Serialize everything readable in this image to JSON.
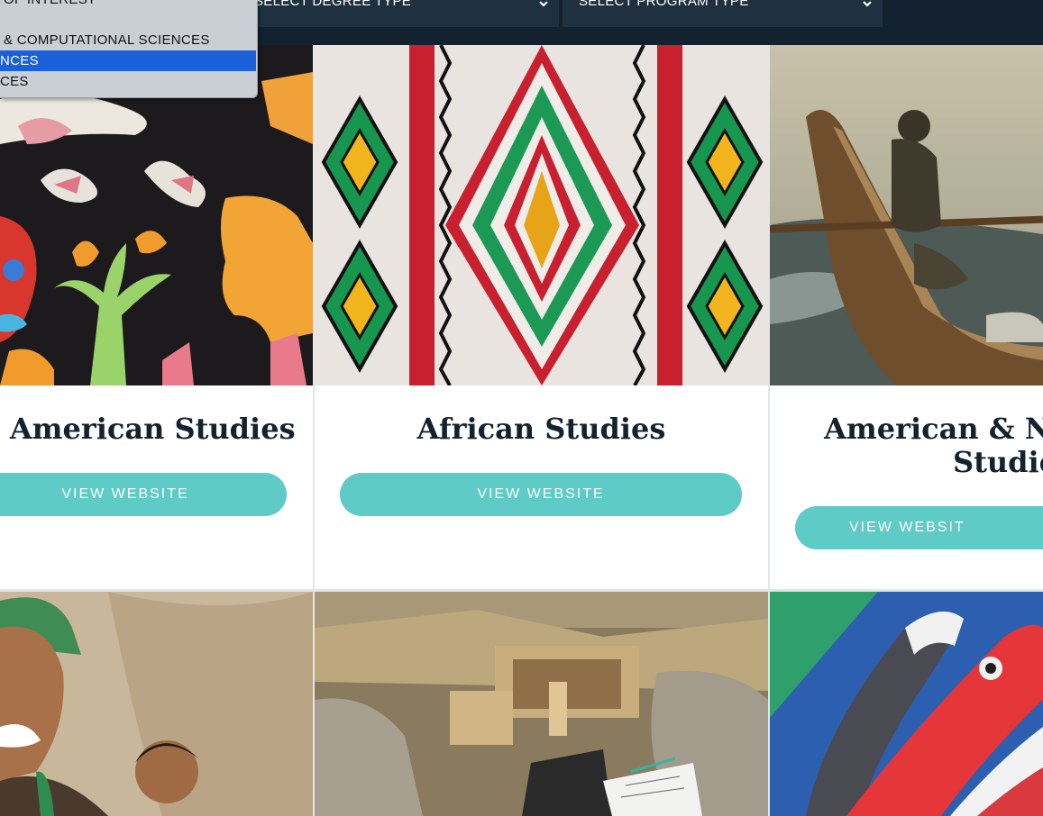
{
  "filters": {
    "area_partial": "OF INTEREST",
    "degree_label": "SELECT DEGREE TYPE",
    "program_label": "SELECT PROGRAM TYPE"
  },
  "dropdown": {
    "options": [
      "OF INTEREST",
      "& COMPUTATIONAL SCIENCES",
      "NCES",
      "CES"
    ],
    "selected_index": 2
  },
  "cards": [
    {
      "title": "n American Studies",
      "button": "VIEW WEBSITE"
    },
    {
      "title": "African Studies",
      "button": "VIEW WEBSITE"
    },
    {
      "title_line1": "American & New",
      "title_line2": "Studies",
      "button": "VIEW WEBSIT"
    }
  ],
  "colors": {
    "topbar": "#13222e",
    "button": "#5ecbc6",
    "selected_option": "#1a61d9"
  }
}
